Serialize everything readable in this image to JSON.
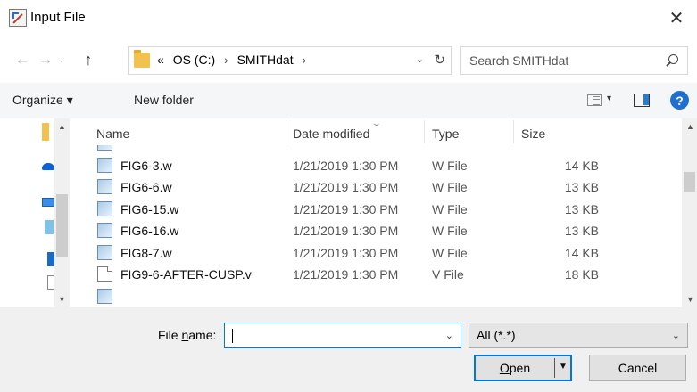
{
  "window": {
    "title": "Input File",
    "close_glyph": "✕"
  },
  "nav": {
    "back_glyph": "←",
    "forward_glyph": "→",
    "recent_glyph": "⌄",
    "up_glyph": "↑"
  },
  "address": {
    "overflow": "«",
    "crumbs": [
      "OS (C:)",
      "SMITHdat"
    ],
    "sep": "›",
    "drop_glyph": "⌄",
    "refresh_glyph": "↻"
  },
  "search": {
    "placeholder": "Search SMITHdat"
  },
  "toolbar": {
    "organize_label": "Organize ▾",
    "new_folder_label": "New folder",
    "view_drop_glyph": "▾",
    "help_glyph": "?"
  },
  "columns": {
    "name": "Name",
    "date": "Date modified",
    "type": "Type",
    "size": "Size"
  },
  "files": [
    {
      "name": "FIG6-3.w",
      "date": "1/21/2019 1:30 PM",
      "type": "W File",
      "size": "14 KB",
      "icon": "w-file-icon"
    },
    {
      "name": "FIG6-6.w",
      "date": "1/21/2019 1:30 PM",
      "type": "W File",
      "size": "13 KB",
      "icon": "w-file-icon"
    },
    {
      "name": "FIG6-15.w",
      "date": "1/21/2019 1:30 PM",
      "type": "W File",
      "size": "13 KB",
      "icon": "w-file-icon"
    },
    {
      "name": "FIG6-16.w",
      "date": "1/21/2019 1:30 PM",
      "type": "W File",
      "size": "13 KB",
      "icon": "w-file-icon"
    },
    {
      "name": "FIG8-7.w",
      "date": "1/21/2019 1:30 PM",
      "type": "W File",
      "size": "14 KB",
      "icon": "w-file-icon"
    },
    {
      "name": "FIG9-6-AFTER-CUSP.v",
      "date": "1/21/2019 1:30 PM",
      "type": "V File",
      "size": "18 KB",
      "icon": "v-file-icon"
    }
  ],
  "bottom": {
    "filename_label_pre": "File ",
    "filename_label_u": "n",
    "filename_label_post": "ame:",
    "filename_value": "",
    "filter_value": "All (*.*)",
    "open_label": "Open",
    "cancel_label": "Cancel"
  },
  "colors": {
    "accent": "#0078d7",
    "help": "#1f6fd0",
    "folder": "#f2c24f"
  }
}
